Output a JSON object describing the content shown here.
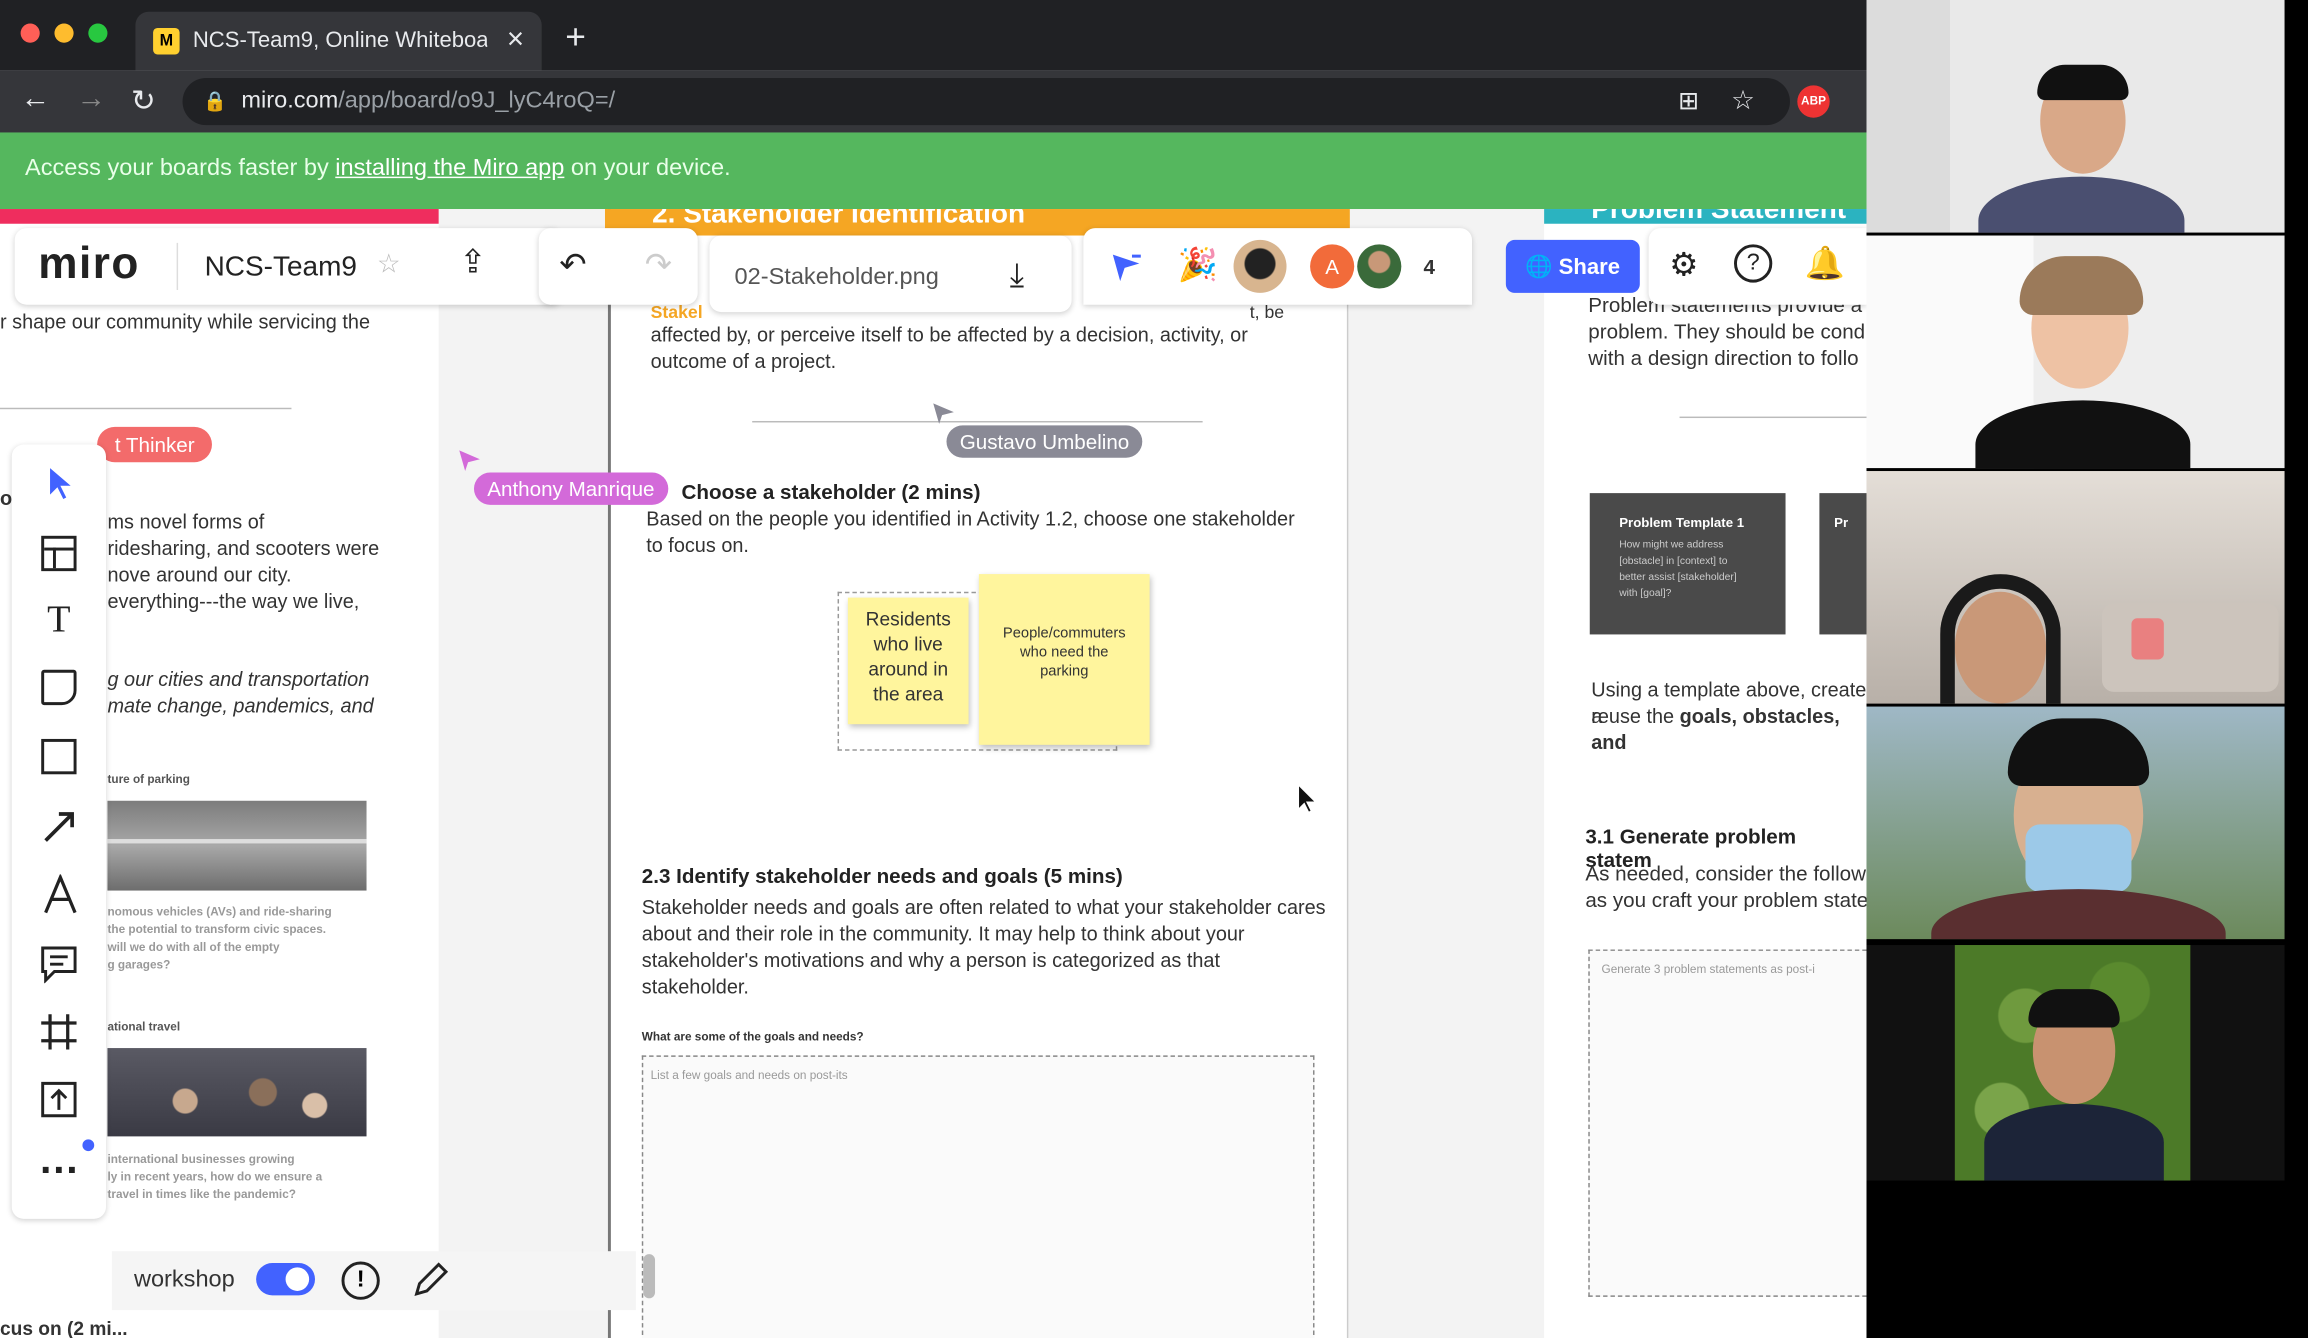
{
  "browser": {
    "tab_title": "NCS-Team9, Online Whiteboa",
    "url_domain": "miro.com",
    "url_path": "/app/board/o9J_lyC4roQ=/",
    "ext_badge": "ABP"
  },
  "banner": {
    "prefix": "Access your boards faster by ",
    "link": "installing the Miro app",
    "suffix": " on your device."
  },
  "miro": {
    "logo": "miro",
    "board_name": "NCS-Team9",
    "file_name": "02-Stakeholder.png",
    "collaborator_initial": "A",
    "collaborator_count": "4",
    "share_label": "Share"
  },
  "frames": {
    "left": {
      "intro": "r shape our community while servicing the",
      "tag": "t Thinker",
      "para_prefix": "o",
      "para": "ms novel forms of\nridesharing, and scooters were\nnove around our city.\neverything---the way we live,",
      "italic": "g our cities and transportation\nmate change, pandemics, and",
      "img1_label": "ture of parking",
      "img1_caption": "nomous vehicles (AVs) and ride-sharing\nthe potential to transform civic spaces.\nwill we do with all of the empty\ng garages?",
      "img2_label": "ational travel",
      "img2_caption": "international businesses growing\nly in recent years, how do we ensure a\ntravel in times like the pandemic?",
      "bottom": "cus on (2 mi..."
    },
    "center": {
      "title": "2. Stakeholder Identification",
      "top_text": "affected by, or perceive itself to be affected by a decision, activity, or\noutcome of a project.",
      "stake_fragment": "Stakel",
      "be_fragment": "t, be",
      "section1_title": "Choose a stakeholder (2 mins)",
      "section1_body": "Based on the people you identified in Activity 1.2, choose one stakeholder\nto focus on.",
      "sticky1": "Residents\nwho live\naround in\nthe area",
      "sticky2": "People/commuters\nwho need the\nparking",
      "section2_title": "2.3 Identify stakeholder needs and goals (5 mins)",
      "section2_body": "Stakeholder needs and goals are often related to what your stakeholder cares\nabout and their role in the community. It may help to think about your\nstakeholder's motivations and why a person is categorized as that\nstakeholder.",
      "question": "What are some of the goals and needs?",
      "placeholder": "List a few goals and needs on post-its"
    },
    "right": {
      "title": "Problem Statement",
      "top_text": "Problem statements provide a\nproblem. They should be cond\nwith a design direction to follo",
      "template_title": "Problem Template 1",
      "template_body": "How might we address\n[obstacle] in [context] to\nbetter assist [stakeholder]\nwith [goal]?",
      "template2_title": "Pr",
      "template_note": "Using a template above, create a",
      "template_note2_prefix": "reuse the ",
      "template_note2_bold": "goals, obstacles, and",
      "section_title": "3.1 Generate problem statem",
      "section_body": "As needed, consider the follow\nas you craft your problem state",
      "box_label": "Generate 3 problem statements as post-i"
    }
  },
  "cursors": [
    {
      "name": "Gustavo Umbelino",
      "color": "#8a8a96"
    },
    {
      "name": "Anthony Manrique",
      "color": "#d36ad9"
    }
  ],
  "bottom_bar": {
    "label": "workshop"
  },
  "colors": {
    "banner": "#55b75e",
    "miro_accent": "#4262ff",
    "frame_orange": "#f5a623",
    "frame_teal": "#2bb3c0",
    "frame_pink": "#ef2d5e"
  }
}
